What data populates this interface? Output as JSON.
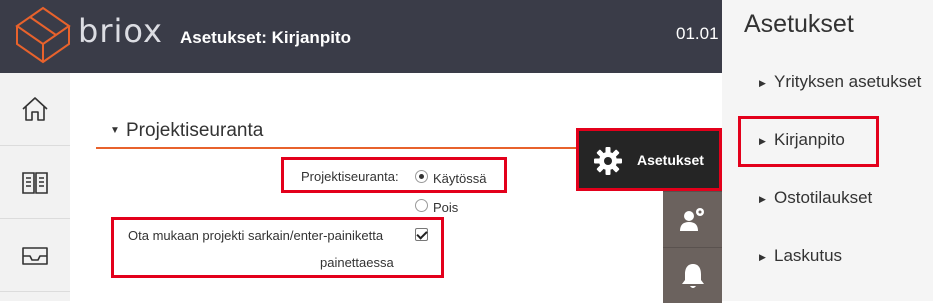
{
  "header": {
    "logo_text": "briox",
    "page_title": "Asetukset: Kirjanpito",
    "date_text": "01.01"
  },
  "leftnav": {
    "items": [
      {
        "icon": "home-icon"
      },
      {
        "icon": "book-icon"
      },
      {
        "icon": "inbox-icon"
      }
    ]
  },
  "section": {
    "title": "Projektiseuranta",
    "project_tracking_label": "Projektiseuranta:",
    "option_enabled": "Käytössä",
    "option_disabled": "Pois",
    "selected_option": "Käytössä",
    "include_project_label_line1": "Ota mukaan projekti sarkain/enter-painiketta",
    "include_project_label_line2": "painettaessa",
    "include_project_checked": true
  },
  "quick_menu": {
    "settings_label": "Asetukset",
    "icons": [
      "gear-icon",
      "users-settings-icon",
      "bell-icon"
    ]
  },
  "settings_panel": {
    "title": "Asetukset",
    "items": [
      {
        "label": "Yrityksen asetukset"
      },
      {
        "label": "Kirjanpito"
      },
      {
        "label": "Ostotilaukset"
      },
      {
        "label": "Laskutus"
      }
    ],
    "active_item": "Kirjanpito"
  },
  "colors": {
    "topbar": "#3a3c48",
    "accent_orange": "#e8622c",
    "highlight_red": "#e3001b",
    "quick_menu_dark": "#252525",
    "side_button": "#6b625e"
  }
}
